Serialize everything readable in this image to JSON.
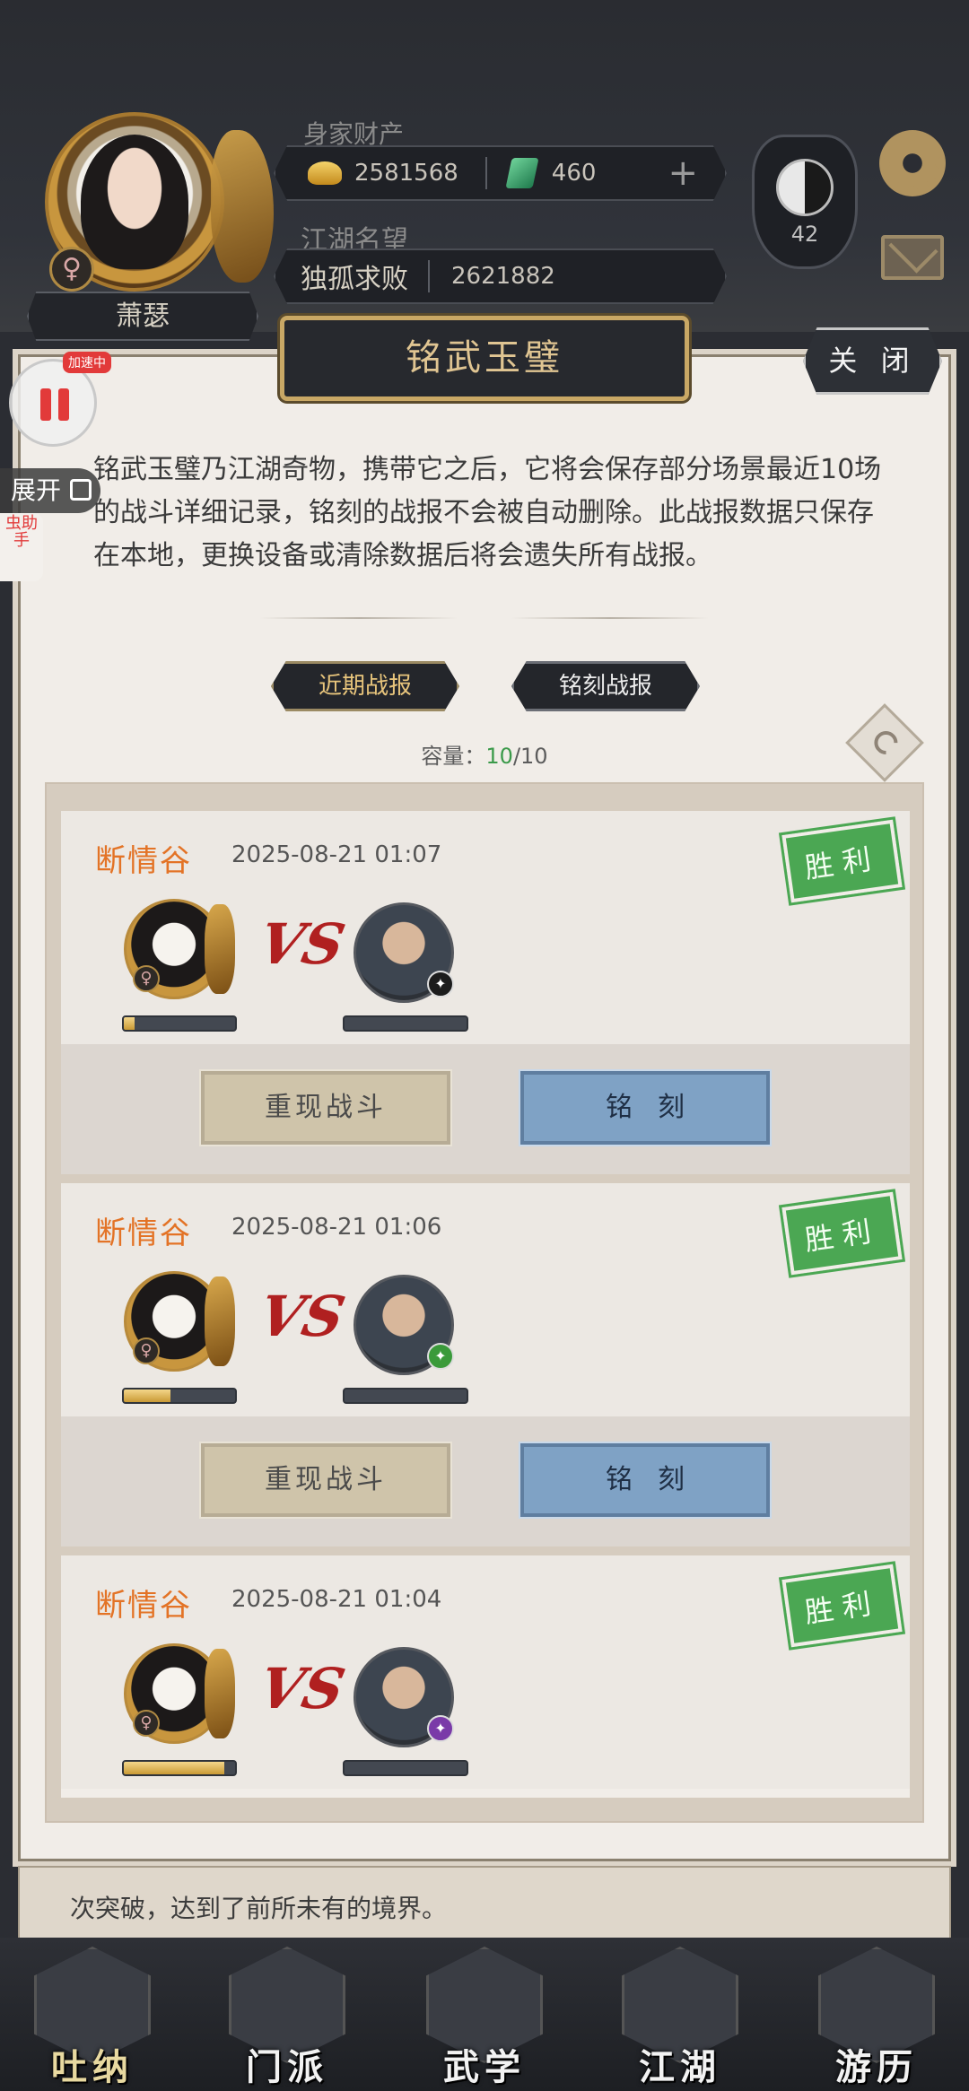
{
  "header": {
    "player_name": "萧瑟",
    "gender_symbol": "♀",
    "wealth_label": "身家财产",
    "gold": "2581568",
    "jade": "460",
    "plus": "+",
    "reputation_label": "江湖名望",
    "reputation_title": "独孤求败",
    "reputation_value": "2621882",
    "rank_level": "42",
    "icons": [
      "avatar",
      "gender-female-icon",
      "gold-ingot-icon",
      "jade-icon",
      "plus-icon",
      "taiji-badge-icon",
      "gear-icon",
      "mail-icon"
    ]
  },
  "overlay": {
    "speed_tag": "加速中",
    "expand_label": "展开",
    "helper_label": "虫助手"
  },
  "dialog": {
    "title": "铭武玉璧",
    "close_label": "关 闭",
    "description": "铭武玉璧乃江湖奇物，携带它之后，它将会保存部分场景最近10场的战斗详细记录，铭刻的战报不会被自动删除。此战报数据只保存在本地，更换设备或清除数据后将会遗失所有战报。",
    "tabs": [
      {
        "label": "近期战报",
        "active": true
      },
      {
        "label": "铭刻战报",
        "active": false
      }
    ],
    "capacity_label": "容量：",
    "capacity_used": "10",
    "capacity_total": "/10"
  },
  "battles": [
    {
      "location": "断情谷",
      "time": "2025-08-21 01:07",
      "result": "胜利",
      "player_hp": 0.1,
      "enemy_hp": 0,
      "enemy_badge_color": "#1c1c1c",
      "replay_label": "重现战斗",
      "engrave_label": "铭刻"
    },
    {
      "location": "断情谷",
      "time": "2025-08-21 01:06",
      "result": "胜利",
      "player_hp": 0.42,
      "enemy_hp": 0,
      "enemy_badge_color": "#3a9a3a",
      "replay_label": "重现战斗",
      "engrave_label": "铭刻"
    },
    {
      "location": "断情谷",
      "time": "2025-08-21 01:04",
      "result": "胜利",
      "player_hp": 0.9,
      "enemy_hp": 0,
      "enemy_badge_color": "#7a3aa8"
    }
  ],
  "bottom_log": "次突破，达到了前所未有的境界。",
  "nav": [
    {
      "label": "吐纳",
      "active": true
    },
    {
      "label": "门派",
      "active": false
    },
    {
      "label": "武学",
      "active": false
    },
    {
      "label": "江湖",
      "active": false
    },
    {
      "label": "游历",
      "active": false
    }
  ],
  "colors": {
    "accent_gold": "#e0c592",
    "location_orange": "#e37326",
    "win_green": "#4ba753",
    "engrave_blue": "#7fa2c5",
    "vs_red": "#b02020"
  }
}
